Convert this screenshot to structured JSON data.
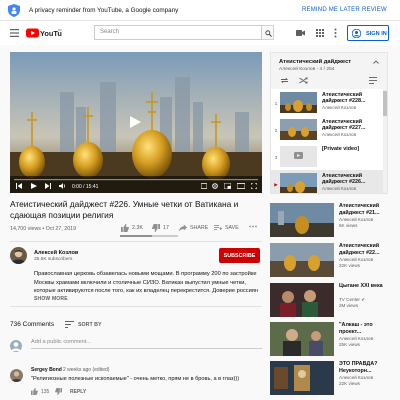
{
  "privacy": {
    "message": "A privacy reminder from YouTube, a Google company",
    "later": "REMIND ME LATER",
    "review": "REVIEW"
  },
  "masthead": {
    "logo_text": "YouTube",
    "region": "RU",
    "search_placeholder": "Search",
    "signin": "SIGN IN"
  },
  "player": {
    "time": "0:00 / 15:41"
  },
  "video": {
    "title": "Атеистический дайджест #226. Умные четки от Ватикана и сдающая позиции религия",
    "meta": "14,700 views • Oct 27, 2019",
    "likes": "2.3K",
    "dislikes": "17",
    "share": "SHARE",
    "save": "SAVE",
    "like_ratio": 0.55
  },
  "channel": {
    "name": "Алексей Козлов",
    "subs": "35.5K subscribers",
    "subscribe": "SUBSCRIBE"
  },
  "description": {
    "text": "Православная церковь обзавелась новыми мощами. В программу 200 по застройке Москвы храмами включили и столичные СИЗО. Ватикан выпустил умные четки, которые активируются после того, как их владелец перекрестится. Доверие россиян",
    "show_more": "SHOW MORE"
  },
  "comments": {
    "count": "736 Comments",
    "sort": "SORT BY",
    "add_placeholder": "Add a public comment...",
    "items": [
      {
        "author": "Sergey Bond",
        "time": "2 weeks ago (edited)",
        "text": "\"Религиозные полезные ископаемые\" - очень метко, прям не в бровь, а в глаз)))",
        "likes": "135",
        "reply": "REPLY"
      }
    ]
  },
  "playlist": {
    "title": "Атеистический дайджест",
    "sub": "Алексей Козлов - 4 / 254",
    "items": [
      {
        "num": "1",
        "title": "Атеистический дайджест #228...",
        "author": "Алексей Козлов"
      },
      {
        "num": "2",
        "title": "Атеистический дайджест #227...",
        "author": "Алексей Козлов"
      },
      {
        "num": "3",
        "title": "[Private video]",
        "author": ""
      },
      {
        "num": "▶",
        "title": "Атеистический дайджест #226...",
        "author": "Алексей Козлов"
      }
    ]
  },
  "recommendations": [
    {
      "title": "Атеистический дайджест #21...",
      "channel": "Алексей Козлов",
      "views": "6K views"
    },
    {
      "title": "Атеистический дайджест #22...",
      "channel": "Алексей Козлов",
      "views": "22K views"
    },
    {
      "title": "Цыгане XXI века",
      "channel": "TV Center ✔",
      "views": "2M views"
    },
    {
      "title": "\"Алкаш - это проект...",
      "channel": "Алексей Козлов",
      "views": "25K views"
    },
    {
      "title": "ЭТО ПРАВДА? Неукоторн...",
      "channel": "Алексей Козлов",
      "views": "22K views"
    }
  ]
}
